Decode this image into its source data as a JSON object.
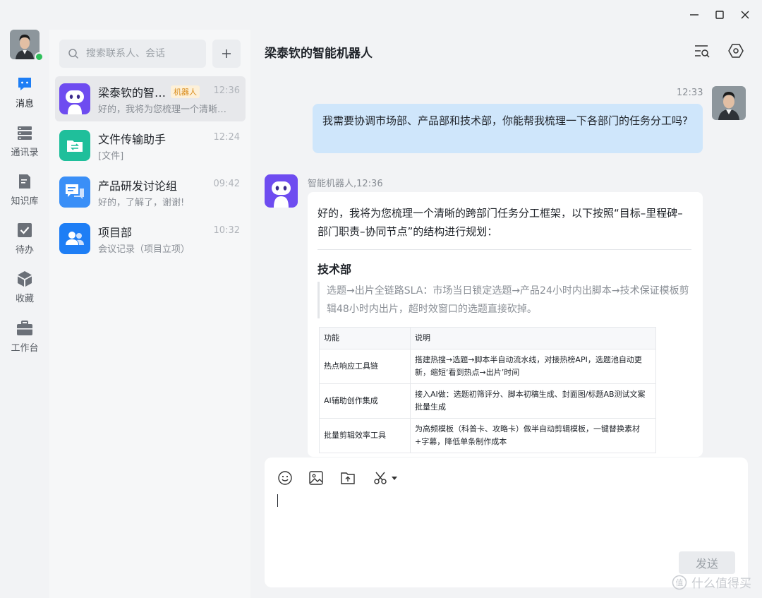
{
  "rail": {
    "items": [
      {
        "label": "消息"
      },
      {
        "label": "通讯录"
      },
      {
        "label": "知识库"
      },
      {
        "label": "待办"
      },
      {
        "label": "收藏"
      },
      {
        "label": "工作台"
      }
    ]
  },
  "search": {
    "placeholder": "搜索联系人、会话"
  },
  "conversations": [
    {
      "name": "梁泰钦的智…",
      "tag": "机器人",
      "time": "12:36",
      "preview": "好的，我将为您梳理一个清晰…"
    },
    {
      "name": "文件传输助手",
      "time": "12:24",
      "preview": "[文件]"
    },
    {
      "name": "产品研发讨论组",
      "time": "09:42",
      "preview": "好的，了解了，谢谢!"
    },
    {
      "name": "项目部",
      "time": "10:32",
      "preview": "会议记录（项目立项）"
    }
  ],
  "chat": {
    "title": "梁泰钦的智能机器人",
    "me": {
      "time": "12:33",
      "text": "我需要协调市场部、产品部和技术部，你能帮我梳理一下各部门的任务分工吗?"
    },
    "bot": {
      "meta": "智能机器人,12:36",
      "intro": "好的，我将为您梳理一个清晰的跨部门任务分工框架，以下按照“目标–里程碑–部门职责–协同节点”的结构进行规划：",
      "heading": "技术部",
      "quote": "选题→出片全链路SLA：市场当日锁定选题→产品24小时内出脚本→技术保证模板剪辑48小时内出片，超时效窗口的选题直接砍掉。",
      "table": {
        "headers": [
          "功能",
          "说明"
        ],
        "rows": [
          [
            "热点响应工具链",
            "搭建热搜→选题→脚本半自动流水线，对接热榜API，选题池自动更新，缩短‘看到热点→出片’时间"
          ],
          [
            "AI辅助创作集成",
            "接入AI做：选题初筛评分、脚本初稿生成、封面图/标题AB测试文案批量生成"
          ],
          [
            "批量剪辑效率工具",
            "为高频模板（科普卡、攻略卡）做半自动剪辑模板，一键替换素材+字幕，降低单条制作成本"
          ]
        ]
      }
    }
  },
  "composer": {
    "send_label": "发送"
  },
  "watermark": {
    "text": "什么值得买"
  },
  "colors": {
    "accent": "#1e7ef5",
    "online": "#2fbf5b",
    "bubble_me": "#cfe6fb",
    "bot": "#6e4cf0"
  }
}
